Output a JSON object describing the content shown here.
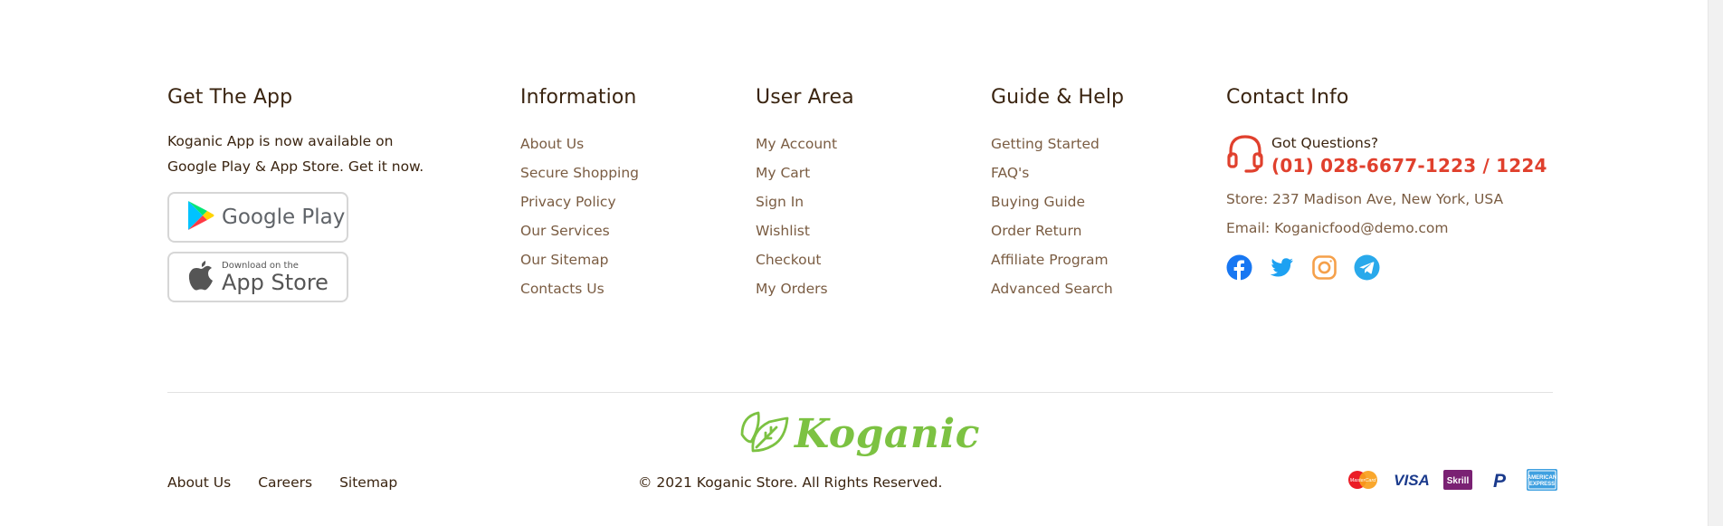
{
  "app": {
    "title": "Get The App",
    "description_line1": "Koganic App is now available on",
    "description_line2": "Google Play & App Store. Get it now.",
    "google_play_label": "Google Play",
    "app_store_small": "Download on the",
    "app_store_label": "App Store"
  },
  "information": {
    "title": "Information",
    "items": [
      "About Us",
      "Secure Shopping",
      "Privacy Policy",
      "Our Services",
      "Our Sitemap",
      "Contacts Us"
    ]
  },
  "user_area": {
    "title": "User Area",
    "items": [
      "My Account",
      "My Cart",
      "Sign In",
      "Wishlist",
      "Checkout",
      "My Orders"
    ]
  },
  "guide": {
    "title": "Guide & Help",
    "items": [
      "Getting Started",
      "FAQ's",
      "Buying Guide",
      "Order Return",
      "Affiliate Program",
      "Advanced Search"
    ]
  },
  "contact": {
    "title": "Contact Info",
    "question": "Got Questions?",
    "phone": "(01) 028-6677-1223 / 1224",
    "store": "Store: 237 Madison Ave, New York, USA",
    "email": "Email: Koganicfood@demo.com",
    "social": [
      "facebook-icon",
      "twitter-icon",
      "instagram-icon",
      "telegram-icon"
    ]
  },
  "bottom": {
    "links": [
      "About Us",
      "Careers",
      "Sitemap"
    ],
    "logo_text": "Koganic",
    "copyright": "© 2021 Koganic Store. All Rights Reserved.",
    "payments": [
      "mastercard-icon",
      "visa-icon",
      "skrill-icon",
      "paypal-icon",
      "amex-icon"
    ],
    "payment_text": {
      "mastercard": "MasterCard",
      "visa": "VISA",
      "skrill": "Skrill",
      "paypal": "P",
      "amex_line1": "AMERICAN",
      "amex_line2": "EXPRESS"
    }
  },
  "colors": {
    "accent_red": "#e0402d",
    "brand_green": "#7cc242",
    "heading": "#3a2410",
    "link": "#7a5c42"
  }
}
